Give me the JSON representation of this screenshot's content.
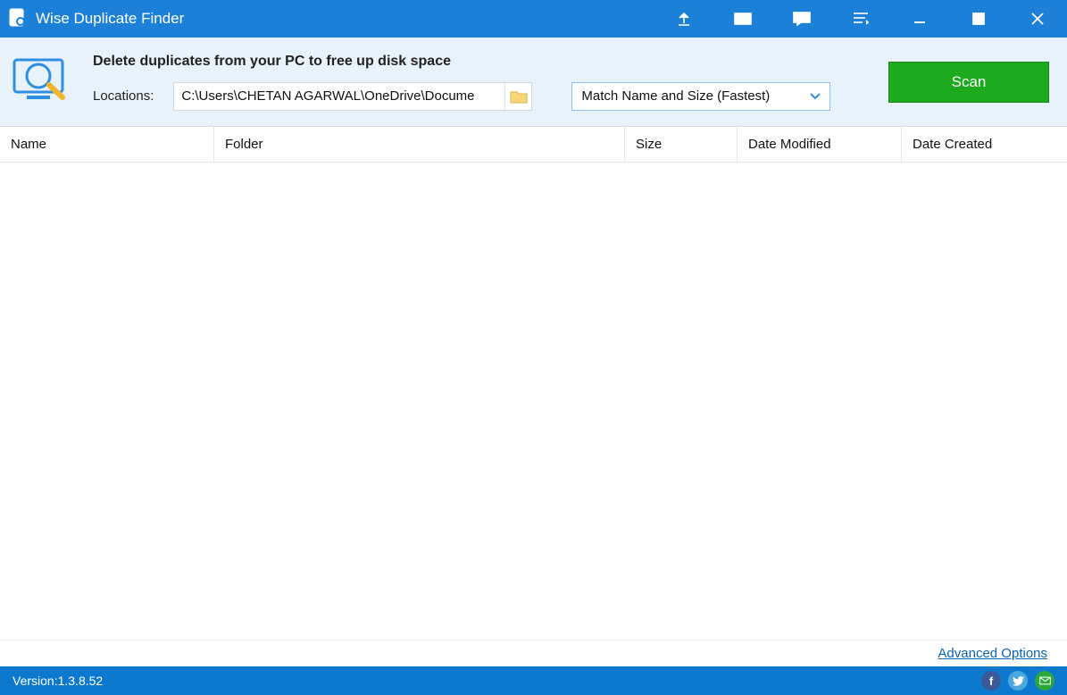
{
  "titlebar": {
    "app_name": "Wise Duplicate Finder"
  },
  "config": {
    "heading": "Delete duplicates from your PC to free up disk space",
    "locations_label": "Locations:",
    "path": "C:\\Users\\CHETAN AGARWAL\\OneDrive\\Docume",
    "match_mode": "Match Name and Size (Fastest)",
    "scan_label": "Scan"
  },
  "columns": {
    "name": "Name",
    "folder": "Folder",
    "size": "Size",
    "modified": "Date Modified",
    "created": "Date Created"
  },
  "footer": {
    "advanced": "Advanced Options"
  },
  "status": {
    "version": "Version:1.3.8.52"
  }
}
